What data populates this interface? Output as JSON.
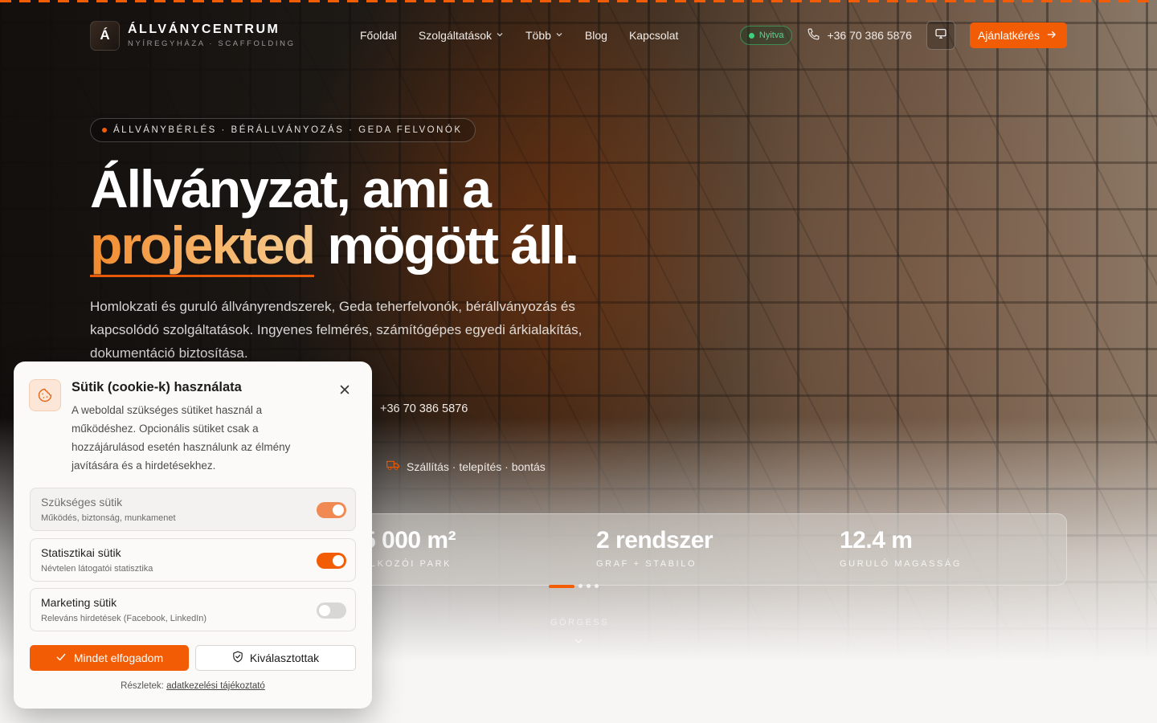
{
  "brand": {
    "mark": "Á",
    "title": "ÁLLVÁNYCENTRUM",
    "subtitle": "NYÍREGYHÁZA · SCAFFOLDING"
  },
  "nav": {
    "items": [
      {
        "label": "Főoldal",
        "dropdown": false
      },
      {
        "label": "Szolgáltatások",
        "dropdown": true
      },
      {
        "label": "Több",
        "dropdown": true
      },
      {
        "label": "Blog",
        "dropdown": false
      },
      {
        "label": "Kapcsolat",
        "dropdown": false
      }
    ]
  },
  "header": {
    "status_badge": "Nyitva",
    "phone": "+36 70 386 5876",
    "cta_label": "Ajánlatkérés",
    "icons": {
      "phone": "phone-icon",
      "display": "monitor-icon",
      "cta_arrow": "arrow-right-icon"
    }
  },
  "hero": {
    "eyebrow": "ÁLLVÁNYBÉRLÉS · BÉRÁLLVÁNYOZÁS · GEDA FELVONÓK",
    "headline_line1": "Állványzat, ami a",
    "headline_accent": "projekted",
    "headline_rest": " mögött áll.",
    "lead": "Homlokzati és guruló állványrendszerek, Geda teherfelvonók, bérállványozás és kapcsolódó szolgáltatások. Ingyenes felmérés, számítógépes egyedi árkialakítás, dokumentáció biztosítása.",
    "phone": "+36 70 386 5876",
    "feature": "Szállítás · telepítés · bontás",
    "feature_icon": "truck-icon"
  },
  "stats": [
    {
      "value": "5 000 m²",
      "label": "ALKOZÓI PARK"
    },
    {
      "value": "2 rendszer",
      "label": "GRAF + STABILO"
    },
    {
      "value": "12.4 m",
      "label": "GURULÓ MAGASSÁG"
    }
  ],
  "scroll": {
    "label": "GÖRGESS",
    "icon": "chevron-down-icon"
  },
  "cookie": {
    "title": "Sütik (cookie-k) használata",
    "description": "A weboldal szükséges sütiket használ a működéshez. Opcionális sütiket csak a hozzájárulásod esetén használunk az élmény javítására és a hirdetésekhez.",
    "icon": "cookie-icon",
    "categories": [
      {
        "title": "Szükséges sütik",
        "subtitle": "Működés, biztonság, munkamenet",
        "enabled": true,
        "locked": true
      },
      {
        "title": "Statisztikai sütik",
        "subtitle": "Névtelen látogatói statisztika",
        "enabled": true,
        "locked": false
      },
      {
        "title": "Marketing sütik",
        "subtitle": "Releváns hirdetések (Facebook, LinkedIn)",
        "enabled": false,
        "locked": false
      }
    ],
    "accept_all_label": "Mindet elfogadom",
    "accept_selected_label": "Kiválasztottak",
    "footer_prefix": "Részletek:",
    "footer_link": "adatkezelési tájékoztató"
  },
  "colors": {
    "accent": "#f25c05",
    "status_green": "#3fcf7d"
  }
}
